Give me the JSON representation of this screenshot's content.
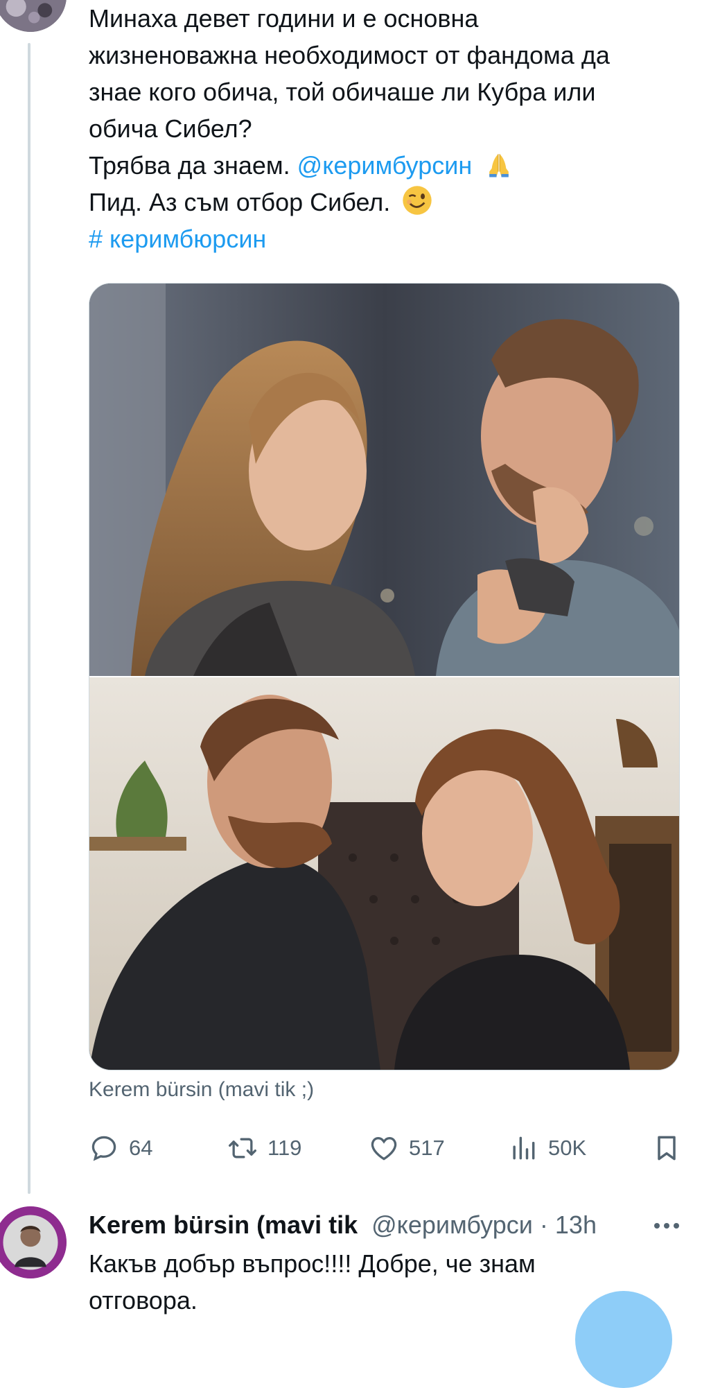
{
  "tweet": {
    "lines": [
      "Минаха девет години и е основна",
      "жизненоважна необходимост от фандома да",
      "знае кого обича, той обичаше ли Кубра или",
      "обича Сибел?"
    ],
    "line5_text": "Трябва да знаем. ",
    "line5_mention": "@керимбурсин",
    "line5_emoji": "folded-hands-emoji",
    "line6_text": "Пид. Аз съм отбор Сибел.",
    "line6_emoji": "winking-face-emoji",
    "hashtag": "# керимбюрсин",
    "media_caption": "Kerem bürsin (mavi tik ;)",
    "actions": {
      "replies": "64",
      "retweets": "119",
      "likes": "517",
      "views": "50K"
    }
  },
  "reply": {
    "name": "Kerem bürsin (mavi tik",
    "handle": "@керимбурси",
    "time_sep": " · ",
    "time": "13h",
    "lines": [
      "Какъв добър въпрос!!!! Добре, че знам",
      "отговора."
    ]
  },
  "colors": {
    "link": "#1d9bf0",
    "secondary_text": "#536471",
    "thread_line": "#cfd9de"
  }
}
